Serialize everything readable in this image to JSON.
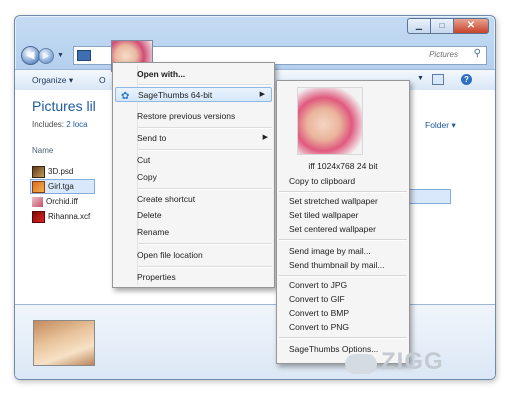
{
  "explorer": {
    "address_text": "Pictures",
    "toolbar": {
      "organize": "Organize ▾",
      "organize_cut": "O"
    },
    "library_title": "Pictures lil",
    "includes_label": "Includes:",
    "includes_link": "2 loca",
    "arrange": "Folder ▾",
    "column_header": "Name",
    "files": [
      "3D.psd",
      "Girl.tga",
      "Orchid.iff",
      "Rihanna.xcf"
    ],
    "caption": {
      "min": "▁",
      "max": "□",
      "close": "✕"
    }
  },
  "context_menu": {
    "open_with": "Open with...",
    "sagethumbs": "SageThumbs 64-bit",
    "restore": "Restore previous versions",
    "send_to": "Send to",
    "cut": "Cut",
    "copy": "Copy",
    "create_shortcut": "Create shortcut",
    "delete": "Delete",
    "rename": "Rename",
    "open_location": "Open file location",
    "properties": "Properties"
  },
  "submenu": {
    "image_info": "iff 1024x768 24 bit",
    "items": [
      "Copy to clipboard",
      "Set stretched wallpaper",
      "Set tiled wallpaper",
      "Set centered wallpaper",
      "Send image by mail...",
      "Send thumbnail by mail...",
      "Convert to JPG",
      "Convert to GIF",
      "Convert to BMP",
      "Convert to PNG",
      "SageThumbs Options..."
    ]
  },
  "watermark": "ZIGG"
}
